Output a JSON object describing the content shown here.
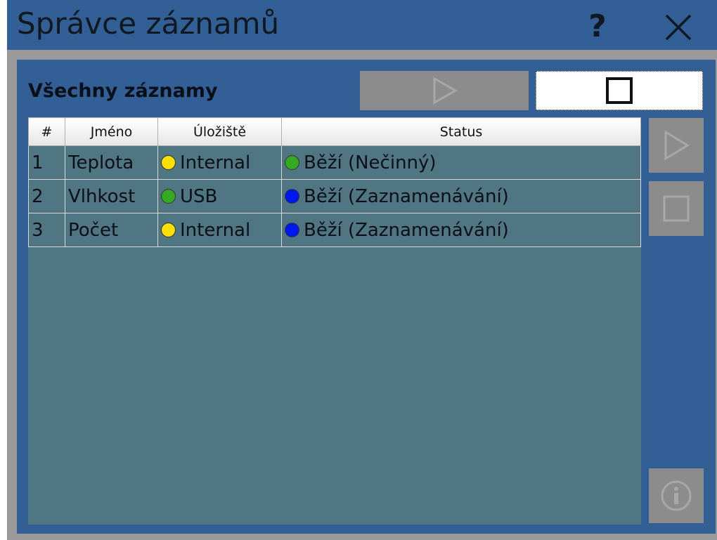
{
  "window": {
    "title": "Správce záznamů",
    "help_label": "?"
  },
  "section": {
    "title": "Všechny záznamy"
  },
  "table": {
    "columns": [
      "#",
      "Jméno",
      "Úložiště",
      "Status"
    ],
    "rows": [
      {
        "num": "1",
        "name": "Teplota",
        "storage": "Internal",
        "storage_color": "#ffe000",
        "status": "Běží (Nečinný)",
        "status_color": "#33aa22"
      },
      {
        "num": "2",
        "name": "Vlhkost",
        "storage": "USB",
        "storage_color": "#33aa22",
        "status": "Běží (Zaznamenávání)",
        "status_color": "#0018f0"
      },
      {
        "num": "3",
        "name": "Počet",
        "storage": "Internal",
        "storage_color": "#ffe000",
        "status": "Běží (Zaznamenávání)",
        "status_color": "#0018f0"
      }
    ]
  },
  "icons": {
    "help": "question-mark-icon",
    "close": "close-x-icon",
    "start_all": "play-icon",
    "stop_all": "stop-square-icon",
    "start_selected": "play-icon",
    "stop_selected": "stop-square-icon",
    "info": "info-icon"
  },
  "colors": {
    "title_bar": "#325f95",
    "panel": "#325f95",
    "frame": "#9a9a9a",
    "table_background": "#517683",
    "disabled_button": "#8c8c8c"
  }
}
